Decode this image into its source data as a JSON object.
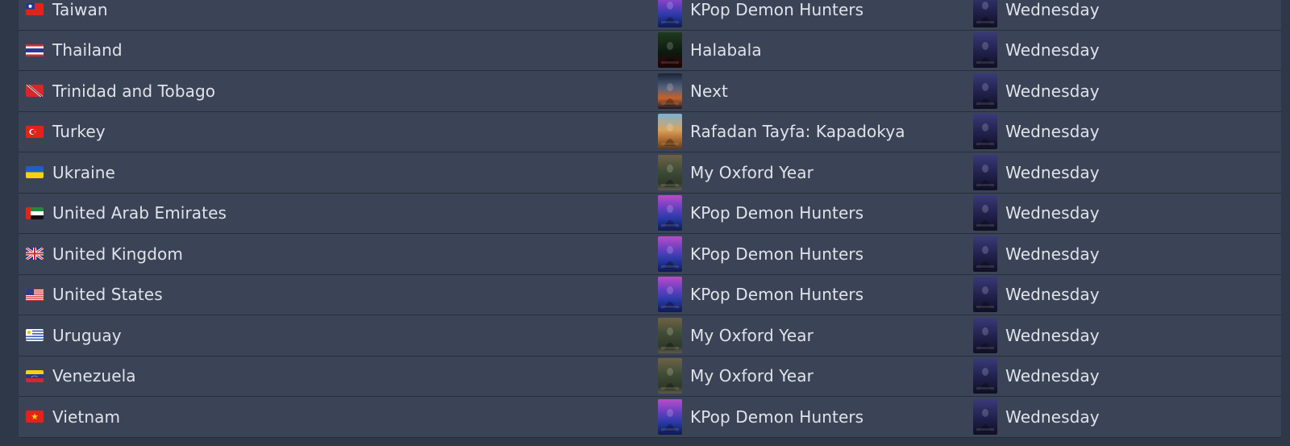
{
  "rows": [
    {
      "country": "Taiwan",
      "flag": "tw",
      "movie": "KPop Demon Hunters",
      "movie_poster": "kpop",
      "show": "Wednesday",
      "show_poster": "wed"
    },
    {
      "country": "Thailand",
      "flag": "th",
      "movie": "Halabala",
      "movie_poster": "hala",
      "show": "Wednesday",
      "show_poster": "wed"
    },
    {
      "country": "Trinidad and Tobago",
      "flag": "tt",
      "movie": "Next",
      "movie_poster": "next",
      "show": "Wednesday",
      "show_poster": "wed"
    },
    {
      "country": "Turkey",
      "flag": "tr",
      "movie": "Rafadan Tayfa: Kapadokya",
      "movie_poster": "rafa",
      "show": "Wednesday",
      "show_poster": "wed"
    },
    {
      "country": "Ukraine",
      "flag": "ua",
      "movie": "My Oxford Year",
      "movie_poster": "oxford",
      "show": "Wednesday",
      "show_poster": "wed"
    },
    {
      "country": "United Arab Emirates",
      "flag": "ae",
      "movie": "KPop Demon Hunters",
      "movie_poster": "kpop",
      "show": "Wednesday",
      "show_poster": "wed"
    },
    {
      "country": "United Kingdom",
      "flag": "gb",
      "movie": "KPop Demon Hunters",
      "movie_poster": "kpop",
      "show": "Wednesday",
      "show_poster": "wed"
    },
    {
      "country": "United States",
      "flag": "us",
      "movie": "KPop Demon Hunters",
      "movie_poster": "kpop",
      "show": "Wednesday",
      "show_poster": "wed"
    },
    {
      "country": "Uruguay",
      "flag": "uy",
      "movie": "My Oxford Year",
      "movie_poster": "oxford",
      "show": "Wednesday",
      "show_poster": "wed"
    },
    {
      "country": "Venezuela",
      "flag": "ve",
      "movie": "My Oxford Year",
      "movie_poster": "oxford",
      "show": "Wednesday",
      "show_poster": "wed"
    },
    {
      "country": "Vietnam",
      "flag": "vn",
      "movie": "KPop Demon Hunters",
      "movie_poster": "kpop",
      "show": "Wednesday",
      "show_poster": "wed"
    }
  ]
}
